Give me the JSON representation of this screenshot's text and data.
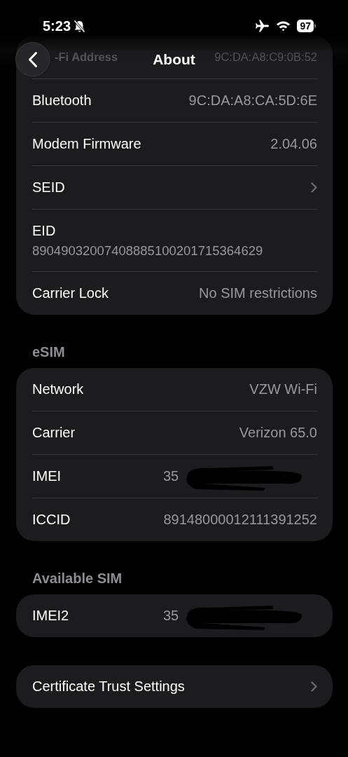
{
  "status_bar": {
    "time": "5:23",
    "silent": true,
    "battery": "97"
  },
  "nav": {
    "title": "About"
  },
  "sections": [
    {
      "rows": [
        {
          "kind": "obscured",
          "label": "-Fi Address",
          "value": "9C:DA:A8:C9:0B:52"
        },
        {
          "kind": "value",
          "label": "Bluetooth",
          "value": "9C:DA:A8:CA:5D:6E"
        },
        {
          "kind": "value",
          "label": "Modem Firmware",
          "value": "2.04.06"
        },
        {
          "kind": "disclosure",
          "label": "SEID"
        },
        {
          "kind": "stacked",
          "label": "EID",
          "value": "89049032007408885100201715364629"
        },
        {
          "kind": "value",
          "label": "Carrier Lock",
          "value": "No SIM restrictions"
        }
      ]
    },
    {
      "header": "eSIM",
      "rows": [
        {
          "kind": "value",
          "label": "Network",
          "value": "VZW Wi-Fi"
        },
        {
          "kind": "value",
          "label": "Carrier",
          "value": "Verizon 65.0"
        },
        {
          "kind": "redacted",
          "label": "IMEI",
          "value": "35"
        },
        {
          "kind": "value",
          "label": "ICCID",
          "value": "89148000012111391252"
        }
      ]
    },
    {
      "header": "Available SIM",
      "rows": [
        {
          "kind": "redacted",
          "label": "IMEI2",
          "value": "35"
        }
      ]
    },
    {
      "rows": [
        {
          "kind": "disclosure",
          "label": "Certificate Trust Settings"
        }
      ]
    }
  ]
}
